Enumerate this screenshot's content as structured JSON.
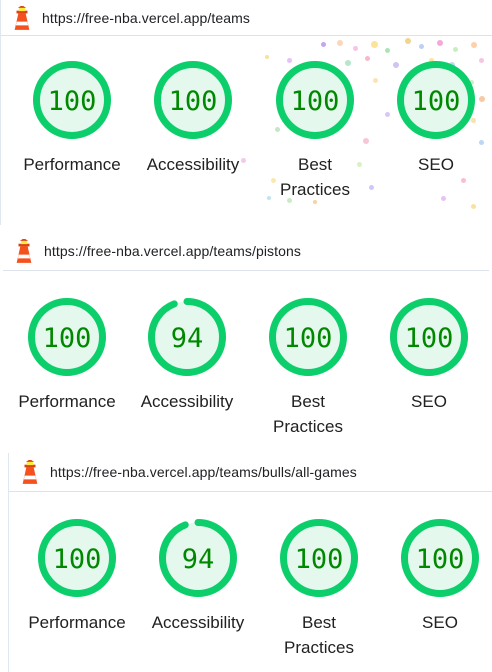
{
  "colors": {
    "pass": "#0cce6b",
    "pass_text": "#008800",
    "pass_fill": "#e5f8ee",
    "track": "#d9f5e6"
  },
  "reports": [
    {
      "url": "https://free-nba.vercel.app/teams",
      "gauges": [
        {
          "score": "100",
          "value": 100,
          "label": "Performance"
        },
        {
          "score": "100",
          "value": 100,
          "label": "Accessibility"
        },
        {
          "score": "100",
          "value": 100,
          "label": "Best Practices"
        },
        {
          "score": "100",
          "value": 100,
          "label": "SEO"
        }
      ]
    },
    {
      "url": "https://free-nba.vercel.app/teams/pistons",
      "gauges": [
        {
          "score": "100",
          "value": 100,
          "label": "Performance"
        },
        {
          "score": "94",
          "value": 94,
          "label": "Accessibility"
        },
        {
          "score": "100",
          "value": 100,
          "label": "Best Practices"
        },
        {
          "score": "100",
          "value": 100,
          "label": "SEO"
        }
      ]
    },
    {
      "url": "https://free-nba.vercel.app/teams/bulls/all-games",
      "gauges": [
        {
          "score": "100",
          "value": 100,
          "label": "Performance"
        },
        {
          "score": "94",
          "value": 94,
          "label": "Accessibility"
        },
        {
          "score": "100",
          "value": 100,
          "label": "Best Practices"
        },
        {
          "score": "100",
          "value": 100,
          "label": "SEO"
        }
      ]
    }
  ]
}
